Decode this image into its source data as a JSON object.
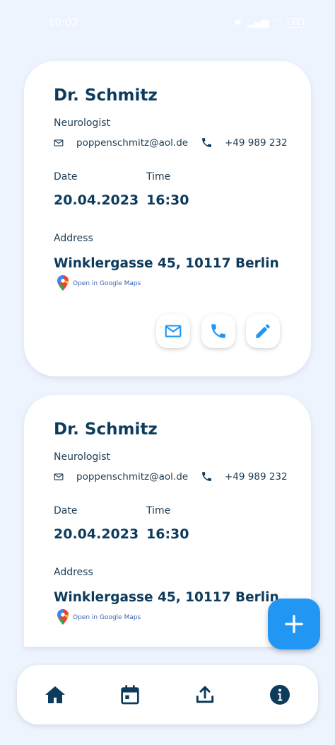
{
  "status_bar": {
    "time": "10:02",
    "battery": "66"
  },
  "appointments": [
    {
      "name": "Dr. Schmitz",
      "specialty": "Neurologist",
      "email": "poppenschmitz@aol.de",
      "phone": "+49 989 232",
      "date_label": "Date",
      "date": "20.04.2023",
      "time_label": "Time",
      "time": "16:30",
      "address_label": "Address",
      "address": "Winklergasse 45, 10117 Berlin",
      "maps_label": "Open in Google Maps"
    },
    {
      "name": "Dr. Schmitz",
      "specialty": "Neurologist",
      "email": "poppenschmitz@aol.de",
      "phone": "+49 989 232",
      "date_label": "Date",
      "date": "20.04.2023",
      "time_label": "Time",
      "time": "16:30",
      "address_label": "Address",
      "address": "Winklergasse 45, 10117 Berlin",
      "maps_label": "Open in Google Maps"
    }
  ],
  "card_actions": [
    "mail-icon",
    "phone-icon",
    "edit-icon"
  ],
  "fab": {
    "icon": "add-icon"
  },
  "bottom_nav": [
    "home-icon",
    "calendar-icon",
    "upload-icon",
    "info-icon"
  ],
  "colors": {
    "accent": "#2196f3",
    "primary_text": "#0d3b5c",
    "background": "#eef4fe",
    "card": "#ffffff"
  }
}
